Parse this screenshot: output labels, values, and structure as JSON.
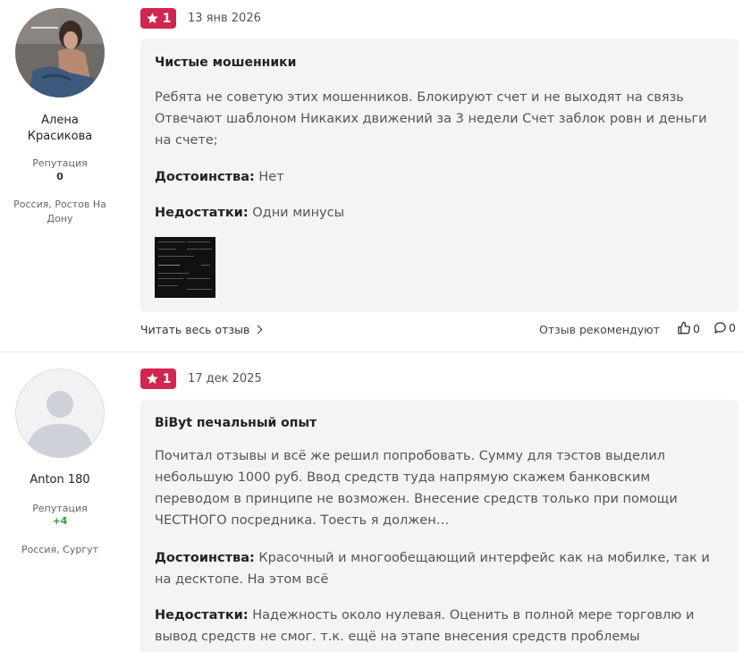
{
  "reviews": [
    {
      "author": {
        "name_line1": "Алена",
        "name_line2": "Красикова",
        "reputation_label": "Репутация",
        "reputation_value": "0",
        "location_line1": "Россия, Ростов На",
        "location_line2": "Дону",
        "avatar": "user-photo"
      },
      "rating": "1",
      "date": "13 янв 2026",
      "title": "Чистые мошенники",
      "body": [
        "Ребята не советую этих мошенников. Блокируют счет и не выходят на связь",
        "Отвечают шаблоном Никаких движений за 3 недели Счет заблок ровн и деньги",
        "на счете;"
      ],
      "pros_label": "Достоинства:",
      "pros": [
        "Нет"
      ],
      "cons_label": "Недостатки:",
      "cons": [
        "Одни минусы"
      ],
      "read_full": "Читать весь отзыв",
      "recommend_label": "Отзыв рекомендуют",
      "likes": "0",
      "comments": "0"
    },
    {
      "author": {
        "name_line1": "Anton 180",
        "reputation_label": "Репутация",
        "reputation_value": "+4",
        "location_line1": "Россия, Сургут",
        "avatar": "default-avatar"
      },
      "rating": "1",
      "date": "17 дек 2025",
      "title": "BiByt печальный опыт",
      "body": [
        "Почитал отзывы и всё же решил попробовать. Сумму для тэстов выделил",
        "небольшую 1000 руб. Ввод средств туда напрямую скажем банковским",
        "переводом в принципе не возможен. Внесение средств только при помощи",
        "ЧЕСТНОГО посредника. Тоесть я должен…"
      ],
      "pros_label": "Достоинства:",
      "pros": [
        "Красочный и многообещающий интерфейс как на мобилке, так и",
        "на десктопе. На этом всё"
      ],
      "cons_label": "Недостатки:",
      "cons": [
        "Надежность около нулевая. Оценить в полной мере торговлю и",
        "вывод средств не смог. т.к. ещё на этапе внесения средств проблемы"
      ]
    }
  ],
  "colors": {
    "badge": "#d1264f",
    "card": "#f4f4f5",
    "positive": "#2e9d41"
  }
}
